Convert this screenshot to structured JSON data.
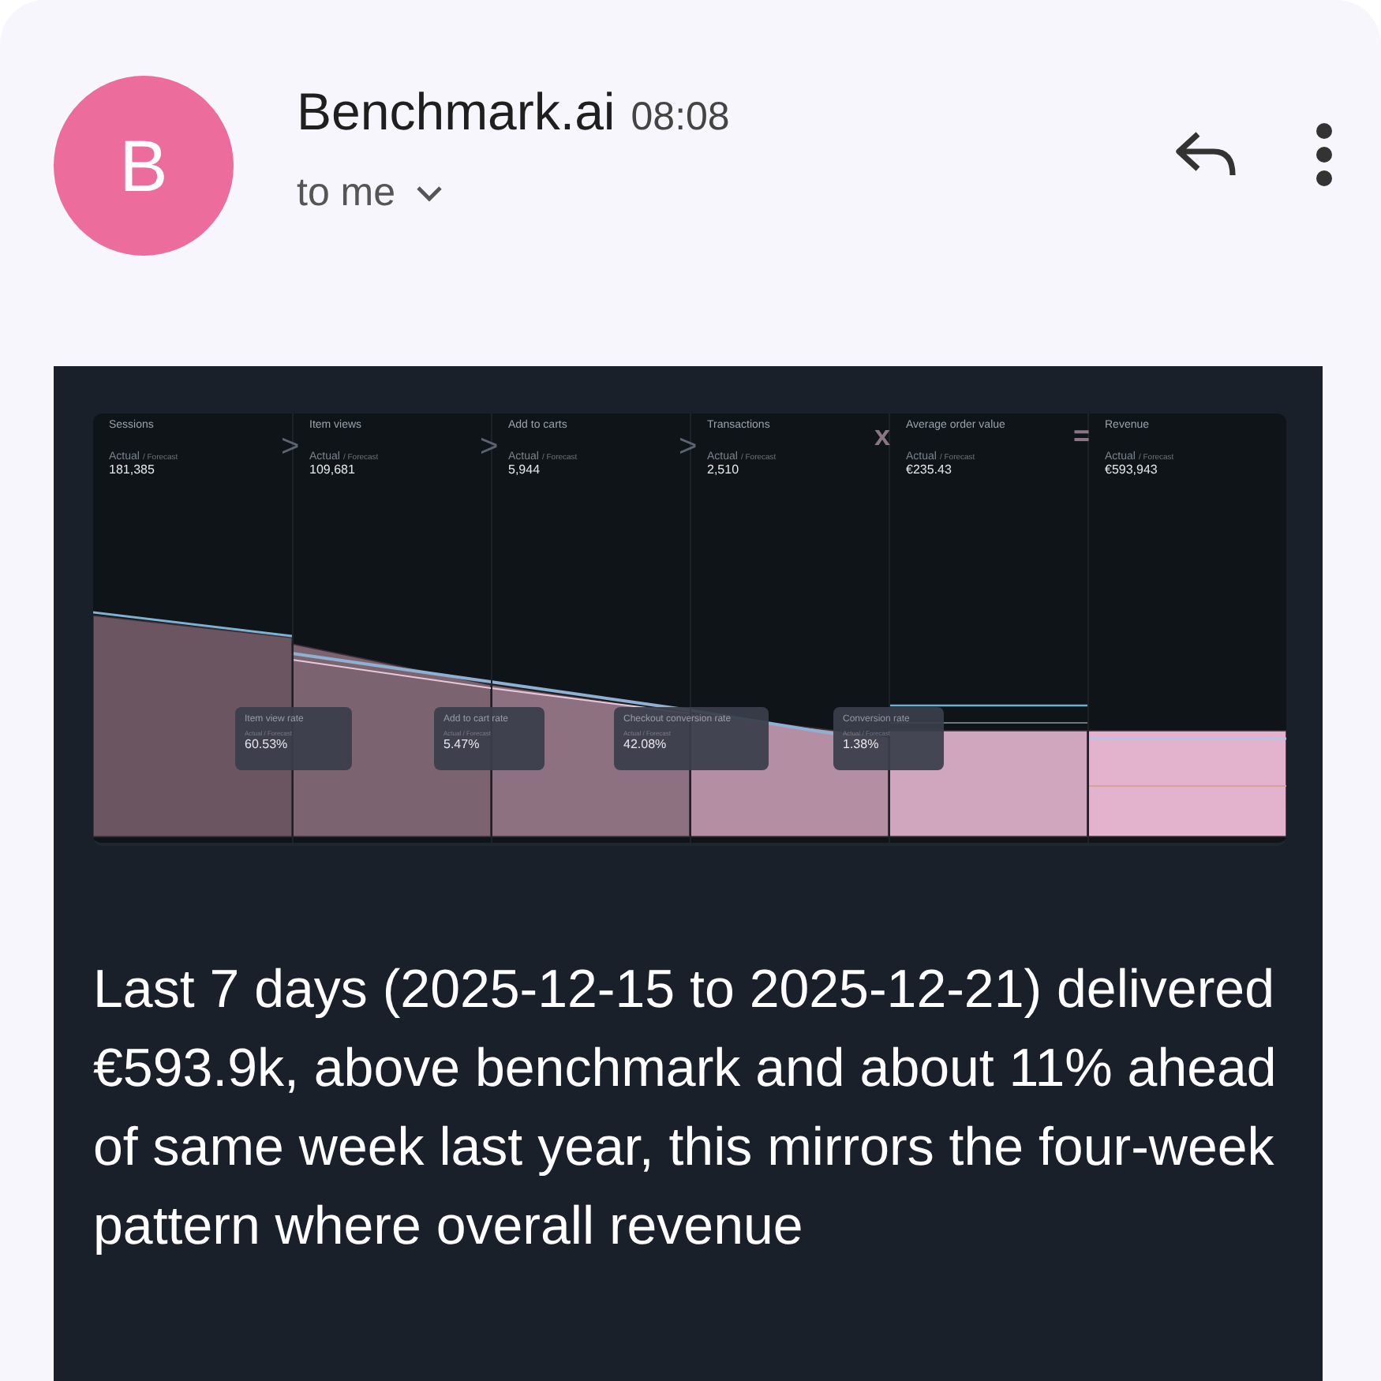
{
  "sender": {
    "initial": "B",
    "name": "Benchmark.ai",
    "time": "08:08",
    "recipient": "to me"
  },
  "funnel": {
    "stages": [
      {
        "label": "Sessions",
        "actual": "Actual",
        "forecast": "/ Forecast",
        "value": "181,385"
      },
      {
        "label": "Item views",
        "operator": ">",
        "actual": "Actual",
        "forecast": "/ Forecast",
        "value": "109,681"
      },
      {
        "label": "Add to carts",
        "operator": ">",
        "actual": "Actual",
        "forecast": "/ Forecast",
        "value": "5,944"
      },
      {
        "label": "Transactions",
        "operator": ">",
        "actual": "Actual",
        "forecast": "/ Forecast",
        "value": "2,510"
      },
      {
        "label": "Average order value",
        "operator": "x",
        "actual": "Actual",
        "forecast": "/ Forecast",
        "value": "€235.43"
      },
      {
        "label": "Revenue",
        "operator": "=",
        "actual": "Actual",
        "forecast": "/ Forecast",
        "value": "€593,943"
      }
    ],
    "rates": [
      {
        "label": "Item view rate",
        "sub": "Actual / Forecast",
        "value": "60.53%"
      },
      {
        "label": "Add to cart rate",
        "sub": "Actual / Forecast",
        "value": "5.47%"
      },
      {
        "label": "Checkout conversion rate",
        "sub": "Actual / Forecast",
        "value": "42.08%"
      },
      {
        "label": "Conversion rate",
        "sub": "Actual / Forecast",
        "value": "1.38%"
      }
    ]
  },
  "body": "Last 7 days (2025-12-15 to 2025-12-21) delivered €593.9k, above benchmark and about 11% ahead of same week last year, this mirrors the four-week pattern where overall revenue"
}
